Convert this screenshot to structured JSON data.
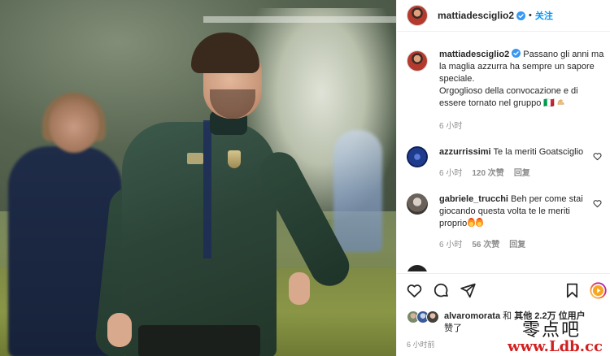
{
  "post": {
    "username": "mattiadesciglio2",
    "dot": "•",
    "follow_label": "关注"
  },
  "caption": {
    "username": "mattiadesciglio2",
    "line1": "Passano gli anni ma la maglia azzurra ha sempre un sapore speciale.",
    "line2": "Orgoglioso della convocazione e di essere tornato nel gruppo 🇮🇹",
    "time": "6 小时"
  },
  "comments": [
    {
      "username": "azzurrissimi",
      "text": "Te la meriti Goatsciglio",
      "time": "6 小时",
      "likes": "120 次赞",
      "reply": "回复"
    },
    {
      "username": "gabriele_trucchi",
      "text": "Beh per come stai giocando questa volta te le meriti proprio",
      "time": "6 小时",
      "likes": "56 次赞",
      "reply": "回复"
    }
  ],
  "likes": {
    "user": "alvaromorata",
    "and": "和",
    "others": "其他 2.2万 位用户",
    "suffix": "赞了"
  },
  "post_time": "6 小时前",
  "watermark": {
    "top": "零点吧",
    "url": "www.Ldb.cc"
  },
  "icons": {
    "like": "heart-icon",
    "comment": "comment-icon",
    "share": "send-icon",
    "save": "bookmark-icon",
    "story": "story-ring-icon",
    "verified": "verified-badge-icon"
  },
  "colors": {
    "link_blue": "#0095f6",
    "muted": "#8e8e8e",
    "text": "#262626",
    "watermark_red": "#d22020"
  }
}
